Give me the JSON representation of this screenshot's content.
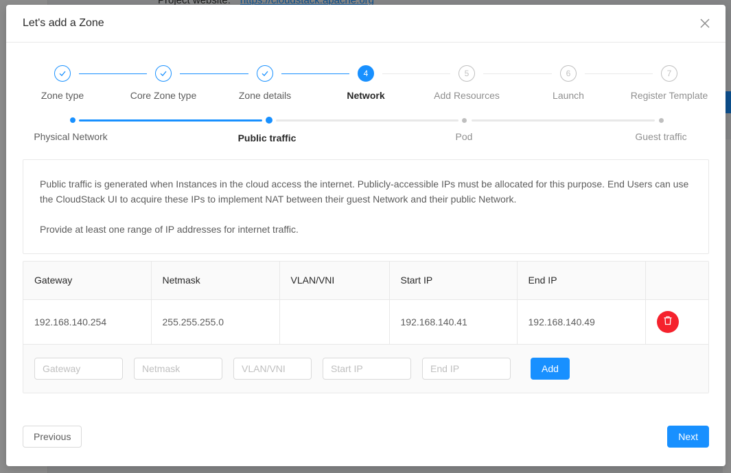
{
  "background": {
    "project_website_label": "* Project website:",
    "project_website_link": "https://cloudstack.apache.org"
  },
  "modal": {
    "title": "Let's add a Zone"
  },
  "steps": [
    {
      "label": "Zone type",
      "status": "finish",
      "number": "1"
    },
    {
      "label": "Core Zone type",
      "status": "finish",
      "number": "2"
    },
    {
      "label": "Zone details",
      "status": "finish",
      "number": "3"
    },
    {
      "label": "Network",
      "status": "process",
      "number": "4"
    },
    {
      "label": "Add Resources",
      "status": "wait",
      "number": "5"
    },
    {
      "label": "Launch",
      "status": "wait",
      "number": "6"
    },
    {
      "label": "Register Template",
      "status": "wait",
      "number": "7"
    }
  ],
  "sub_steps": [
    {
      "label": "Physical Network",
      "status": "finish"
    },
    {
      "label": "Public traffic",
      "status": "process"
    },
    {
      "label": "Pod",
      "status": "wait"
    },
    {
      "label": "Guest traffic",
      "status": "wait"
    }
  ],
  "description": {
    "paragraph1": "Public traffic is generated when Instances in the cloud access the internet. Publicly-accessible IPs must be allocated for this purpose. End Users can use the CloudStack UI to acquire these IPs to implement NAT between their guest Network and their public Network.",
    "paragraph2": "Provide at least one range of IP addresses for internet traffic."
  },
  "table": {
    "columns": [
      "Gateway",
      "Netmask",
      "VLAN/VNI",
      "Start IP",
      "End IP",
      ""
    ],
    "rows": [
      [
        "192.168.140.254",
        "255.255.255.0",
        "",
        "192.168.140.41",
        "192.168.140.49"
      ]
    ]
  },
  "add_form": {
    "gateway_placeholder": "Gateway",
    "netmask_placeholder": "Netmask",
    "vlan_placeholder": "VLAN/VNI",
    "start_ip_placeholder": "Start IP",
    "end_ip_placeholder": "End IP",
    "add_label": "Add"
  },
  "footer": {
    "previous_label": "Previous",
    "next_label": "Next"
  },
  "colors": {
    "primary": "#1890ff",
    "danger": "#f5222d"
  },
  "icons": {
    "close": "close-icon",
    "check": "check-icon",
    "delete": "delete-icon"
  }
}
